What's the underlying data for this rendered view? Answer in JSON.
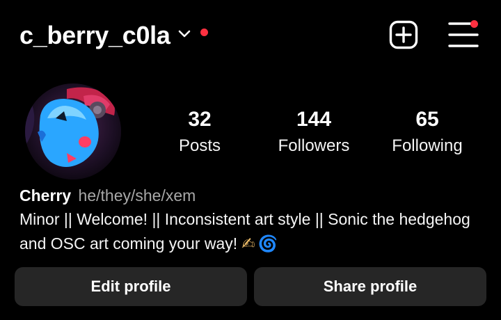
{
  "header": {
    "username": "c_berry_c0la",
    "has_notification": true,
    "accent": "#ff3040",
    "icons": [
      "chevron-down-icon",
      "plus-square-icon",
      "hamburger-menu-icon"
    ]
  },
  "profile": {
    "avatar_alt": "profile picture",
    "stats": [
      {
        "count": "32",
        "label": "Posts"
      },
      {
        "count": "144",
        "label": "Followers"
      },
      {
        "count": "65",
        "label": "Following"
      }
    ],
    "display_name": "Cherry",
    "pronouns": "he/they/she/xem",
    "bio_text": "Minor || Welcome! || Inconsistent art style || Sonic the hedgehog and OSC art coming your way!",
    "bio_emoji_1": "✍",
    "bio_emoji_2": "🌀"
  },
  "actions": {
    "edit_label": "Edit profile",
    "share_label": "Share profile"
  }
}
